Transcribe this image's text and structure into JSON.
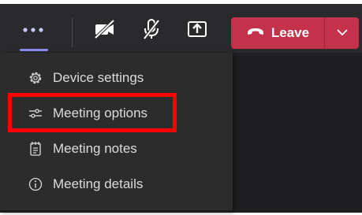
{
  "toolbar": {
    "more": {
      "icon": "more-options-icon"
    },
    "camera": {
      "icon": "camera-off-icon"
    },
    "mic": {
      "icon": "mic-off-icon"
    },
    "share": {
      "icon": "share-screen-icon"
    },
    "leave": {
      "label": "Leave",
      "icon": "phone-hang-up-icon",
      "dropdown_icon": "chevron-down-icon",
      "color": "#c4314b"
    },
    "accent": "#8b8cf2"
  },
  "menu": {
    "items": [
      {
        "label": "Device settings",
        "icon": "gear-icon"
      },
      {
        "label": "Meeting options",
        "icon": "sliders-icon",
        "highlighted": true
      },
      {
        "label": "Meeting notes",
        "icon": "notes-icon"
      },
      {
        "label": "Meeting details",
        "icon": "info-icon"
      }
    ],
    "highlight_color": "#ff0000"
  }
}
